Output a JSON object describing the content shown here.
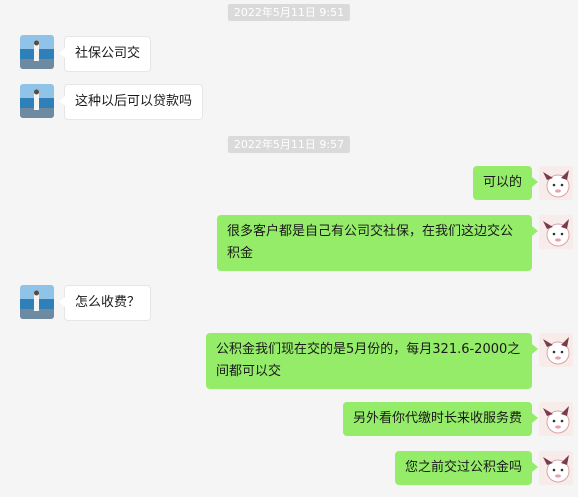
{
  "colors": {
    "background": "#f5f5f5",
    "outgoing_bubble": "#95ec69",
    "incoming_bubble": "#ffffff",
    "timestamp_bg": "#dadada"
  },
  "timestamps": [
    "2022年5月11日 9:51",
    "2022年5月11日 9:57"
  ],
  "messages": [
    {
      "side": "left",
      "avatar": "seaside-avatar",
      "text": "社保公司交"
    },
    {
      "side": "left",
      "avatar": "seaside-avatar",
      "text": "这种以后可以贷款吗"
    },
    {
      "side": "right",
      "avatar": "cartoon-avatar",
      "text": "可以的"
    },
    {
      "side": "right",
      "avatar": "cartoon-avatar",
      "text": "很多客户都是自己有公司交社保，在我们这边交公积金"
    },
    {
      "side": "left",
      "avatar": "seaside-avatar",
      "text": "怎么收费？"
    },
    {
      "side": "right",
      "avatar": "cartoon-avatar",
      "text": "公积金我们现在交的是5月份的，每月321.6-2000之间都可以交"
    },
    {
      "side": "right",
      "avatar": "cartoon-avatar",
      "text": "另外看你代缴时长来收服务费"
    },
    {
      "side": "right",
      "avatar": "cartoon-avatar",
      "text": "您之前交过公积金吗"
    }
  ]
}
